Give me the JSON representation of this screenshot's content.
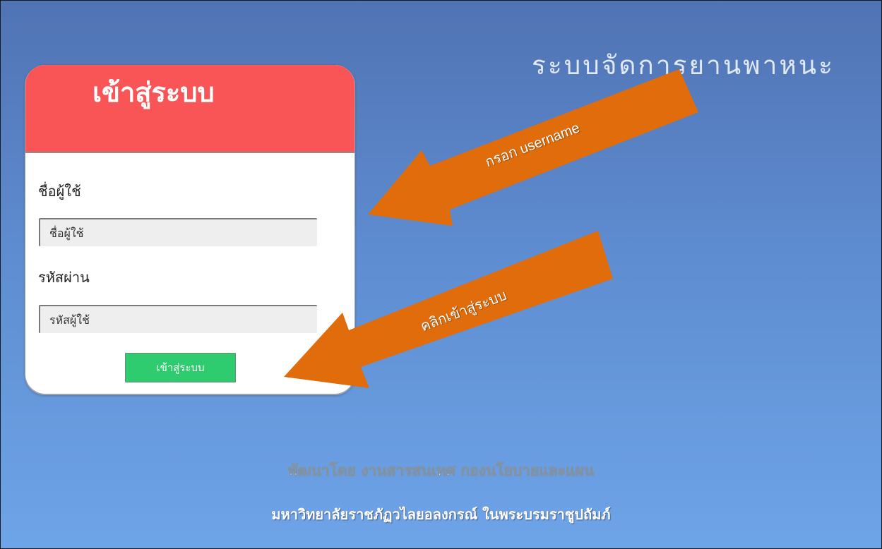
{
  "system_title": "ระบบจัดการยานพาหนะ",
  "login": {
    "title": "เข้าสู่ระบบ",
    "username_label": "ชื่อผู้ใช้",
    "username_placeholder": "ชื่อผู้ใช้",
    "password_label": "รหัสผ่าน",
    "password_placeholder": "รหัสผู้ใช้",
    "submit_label": "เข้าสู่ระบบ"
  },
  "annotations": {
    "username_arrow_label": "กรอก username",
    "login_arrow_label": "คลิกเข้าสู่ระบบ"
  },
  "footer": {
    "developer": "พัฒนาโดย งานสารสนเทศ กองนโยบายและแผน",
    "university": "มหาวิทยาลัยราชภัฏวไลยอลงกรณ์ ในพระบรมราชูปถัมภ์"
  },
  "colors": {
    "header": "#f95557",
    "button": "#2fcb6f",
    "arrow": "#e06c0b",
    "background_top": "#5073b3",
    "background_bottom": "#6ea4e8"
  },
  "icons": {
    "arrow_to_username": "orange-arrow-icon",
    "arrow_to_button": "orange-arrow-icon"
  }
}
